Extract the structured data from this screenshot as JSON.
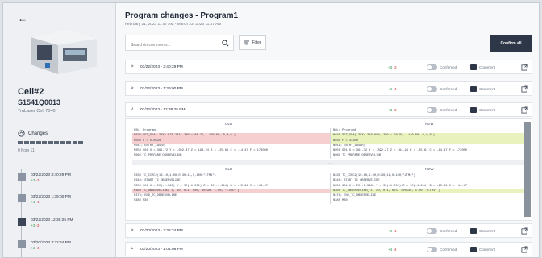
{
  "sidebar": {
    "back_icon": "arrow-left-icon",
    "cell_name": "Cell#2",
    "serial": "S1541Q0013",
    "model": "TruLaser Cell 7040",
    "changes_label": "Changes",
    "progress_label": "0 from 11",
    "timeline": [
      {
        "date": "03/22/2023 3:40:29 PM",
        "plus": "+3",
        "minus": "-3",
        "active": false
      },
      {
        "date": "03/22/2023 1:39:00 PM",
        "plus": "+4",
        "minus": "-4",
        "active": false
      },
      {
        "date": "03/22/2023 12:38:25 PM",
        "plus": "+3",
        "minus": "-3",
        "active": true
      },
      {
        "date": "03/20/2023 3:32:34 PM",
        "plus": "+4",
        "minus": "-4",
        "active": false
      }
    ]
  },
  "header": {
    "title": "Program changes - Program1",
    "date_range": "February 21, 2023 11:47 AM - March 23, 2023 11:47 AM"
  },
  "search": {
    "placeholder": "Search in comments..."
  },
  "filter": {
    "label": "Filter"
  },
  "confirm_all": {
    "label": "Confirm all"
  },
  "rows": [
    {
      "date": "03/22/2023 - 3:40:29 PM",
      "plus": "+3",
      "minus": "-3",
      "confirmed_label": "Confirmed",
      "comment_label": "Comment",
      "expanded": false
    },
    {
      "date": "03/22/2023 - 1:39:00 PM",
      "plus": "+4",
      "minus": "-4",
      "confirmed_label": "Confirmed",
      "comment_label": "Comment",
      "expanded": false
    },
    {
      "date": "03/22/2023 - 12:38:25 PM",
      "plus": "+3",
      "minus": "-3",
      "confirmed_label": "Confirmed",
      "comment_label": "Comment",
      "expanded": true
    },
    {
      "date": "03/20/2023 - 3:32:34 PM",
      "plus": "+4",
      "minus": "-4",
      "confirmed_label": "Confirmed",
      "comment_label": "Comment",
      "expanded": false
    },
    {
      "date": "03/20/2023 - 1:01:08 PM",
      "plus": "+4",
      "minus": "-4",
      "confirmed_label": "Confirmed",
      "comment_label": "Comment",
      "expanded": false
    }
  ],
  "diff": {
    "old_label": "OLD",
    "new_label": "NEW",
    "ellipsis": "...",
    "block1_old": [
      "N0L; Program1",
      "N020 SET_DDA( 35X= 678.244, 200 = 86.75, -110.00, 0,0,0 )",
      "N030 F = 5.8520",
      "N04L; ENTRY_LASER;",
      "N050 G01 X = 361.72 Y = -392.37 Z = 194.24 B = -25.61 C = -14.47 F = 173000",
      "N060 TC_PREPARE_OBSERVELINE"
    ],
    "block1_new": [
      "N0L; Program1",
      "N020 SET_DDA( 35X= 310.600, 200 = 98.95, -110.00, 0,0,0 )",
      "N030 F = 34300",
      "N04L; ENTRY_LASER;",
      "N050 G01 X = 361.72 Y = -392.27 Z = 194.24 B = -25.61 C = -14.47 F = 173000",
      "N060 TC_PREPARE_OBSERVELINE"
    ],
    "block2_old": [
      "N330 TC_CIRC2(10.10,1.00,0.30,11,0,100,\"LTM1\")",
      "N340; START_TC_OBSERVELINE",
      "N350 G01 X = IC(-1.568) Y = IC(-1.051) Z = IC(-1.611) B = -25.61 C = -14.47",
      "N360 TC_OBSERVELINE( 1, 10, 0.1, 900, 40230, 1.00, \"LTM1\" )",
      "N370; END_TC_OBSERVELINE",
      "N380 M30"
    ],
    "block2_new": [
      "N330 TC_CIRC2(10.10,1.00,0.30,11,0,100,\"LTM1\")",
      "N340; START_TC_OBSERVELINE",
      "N350 G01 X = IC(-1.568) Y = IC(-1.051) Z = IC(-1.611) B = -25.61 C = -14.47",
      "N360 TC_OBSERVELINE( 1, 20, 0.1, 675, 405146, 1.00, \"LTM1\" )",
      "N370; END_TC_OBSERVELINE",
      "N380 M30"
    ]
  }
}
